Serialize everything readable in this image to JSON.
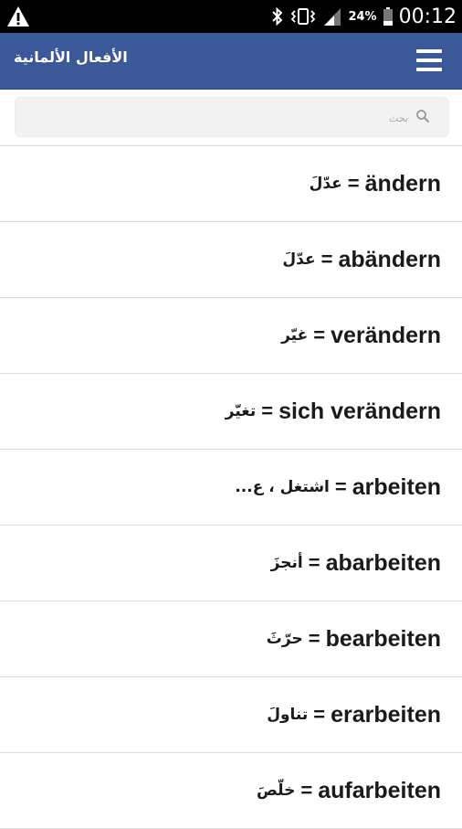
{
  "status_bar": {
    "battery_percent": "24%",
    "time": "00:12",
    "icons": [
      "warning-icon",
      "bluetooth-icon",
      "vibrate-icon",
      "signal-icon",
      "battery-icon"
    ]
  },
  "app_bar": {
    "title": "الأفعال الألمانية",
    "menu_icon": "hamburger-menu-icon",
    "color": "#3b5998"
  },
  "search": {
    "placeholder": "بحث",
    "value": ""
  },
  "verbs": [
    {
      "german": "ändern",
      "arabic": "عدّلَ"
    },
    {
      "german": "abändern",
      "arabic": "عدّلَ"
    },
    {
      "german": "verändern",
      "arabic": "غيّر"
    },
    {
      "german": "sich verändern",
      "arabic": "تغيّر"
    },
    {
      "german": "arbeiten",
      "arabic": "اشتغل ، ع..."
    },
    {
      "german": "abarbeiten",
      "arabic": "أنجزَ"
    },
    {
      "german": "bearbeiten",
      "arabic": "حرّثَ"
    },
    {
      "german": "erarbeiten",
      "arabic": "تناولَ"
    },
    {
      "german": "aufarbeiten",
      "arabic": "خلّصَ"
    }
  ]
}
